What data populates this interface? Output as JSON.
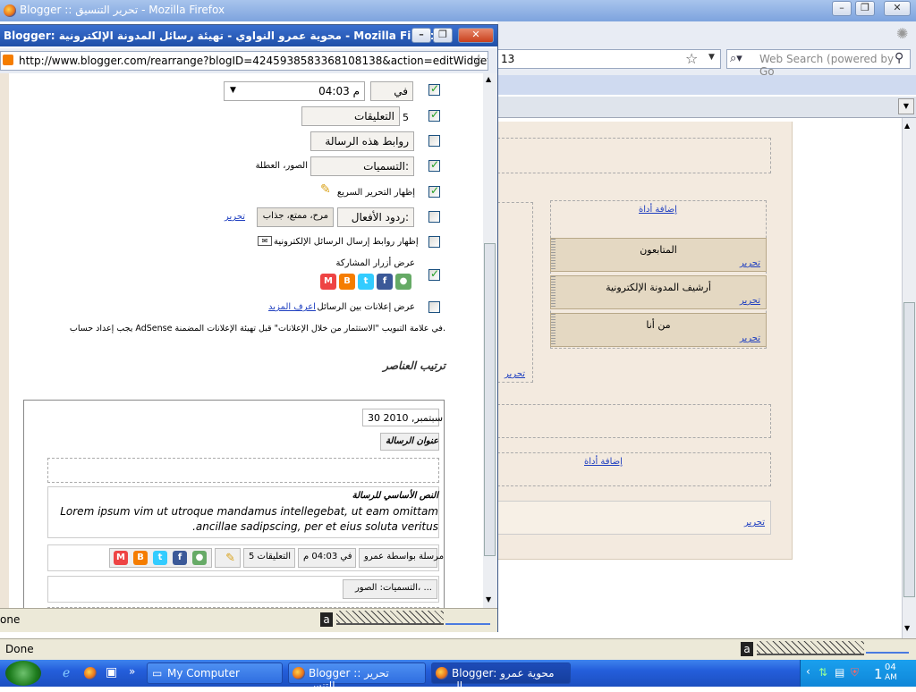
{
  "main_window": {
    "title": "Blogger :: تحرير التنسيق - Mozilla Firefox",
    "url": "13",
    "search_placeholder": "Web Search (powered by Go",
    "status": "Done"
  },
  "layout_editor": {
    "add_gadget_label": "إضافة أداة",
    "gadgets": [
      {
        "title": "المتابعون",
        "edit_label": "تحرير"
      },
      {
        "title": "أرشيف المدونة الإلكترونية",
        "edit_label": "تحرير"
      },
      {
        "title": "من أنا",
        "edit_label": "تحرير"
      }
    ],
    "edit_label": "تحرير",
    "add_gadget_label_2": "إضافة أداة",
    "footer_edit_label": "تحرير"
  },
  "popup": {
    "title": "Blogger: محوية عمرو النواوي - تهيئة رسائل المدونة الإلكترونية - Mozilla Firefox",
    "url": "http://www.blogger.com/rearrange?blogID=4245938583368108138&action=editWidget&section",
    "status": "one",
    "options": {
      "time_prefix": "في",
      "time_value": "04:03 م",
      "comments_count": "5",
      "comments_label": "التعليقات",
      "backlinks_label": "روابط هذه الرسالة",
      "labels_label": "التسميات:",
      "labels_value": "الصور، العطلة",
      "quick_edit_label": "إظهار التحرير السريع",
      "reactions_label": "ردود الأفعال:",
      "reactions_value": "مرح، ممتع، جذاب",
      "reactions_edit": "تحرير",
      "email_links_label": "إظهار روابط إرسال الرسائل الإلكترونية",
      "share_buttons_label": "عرض أزرار المشاركة",
      "ads_label": "عرض إعلانات بين الرسائل",
      "learn_more": "اعرف المزيد",
      "adsense_note": "يجب إعداد حساب AdSense في علامة التبويب \"الاستثمار من خلال الإعلانات\" قبل تهيئة الإعلانات المضمنة."
    },
    "arrange_heading": "ترتيب العناصر",
    "preview": {
      "date": "30 سبتمبر, 2010",
      "post_title": "عنوان الرسالة",
      "body_label": "النص الأساسي للرسالة",
      "body_text_1": "Lorem ipsum vim ut utroque mandamus intellegebat, ut eam omittam",
      "body_text_2": ".ancillae sadipscing, per et eius soluta veritus",
      "posted_by": "مرسلة بواسطة عمرو...",
      "time": "في 04:03 م",
      "comments": "5 التعليقات",
      "labels": "التسميات: الصور، ..."
    }
  },
  "taskbar": {
    "items": [
      "My Computer",
      "Blogger :: تحرير التنس...",
      "Blogger: محوية عمرو ال..."
    ],
    "clock_time": "04",
    "clock_day": "1",
    "clock_ampm": "AM"
  },
  "share_icons": [
    "gmail-icon",
    "blogger-icon",
    "twitter-icon",
    "facebook-icon",
    "buzz-icon"
  ]
}
